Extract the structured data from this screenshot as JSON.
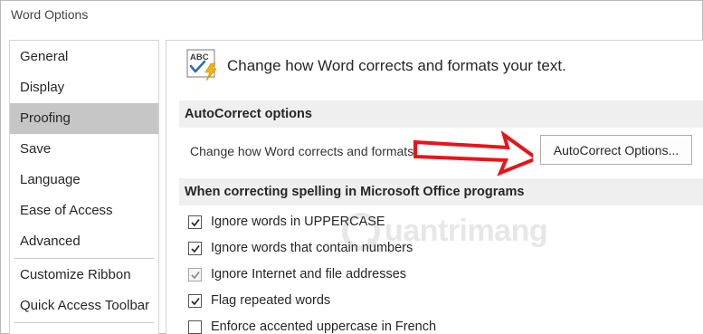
{
  "window": {
    "title": "Word Options"
  },
  "sidebar": {
    "items": [
      {
        "label": "General"
      },
      {
        "label": "Display"
      },
      {
        "label": "Proofing"
      },
      {
        "label": "Save"
      },
      {
        "label": "Language"
      },
      {
        "label": "Ease of Access"
      },
      {
        "label": "Advanced"
      },
      {
        "label": "Customize Ribbon"
      },
      {
        "label": "Quick Access Toolbar"
      }
    ],
    "selected": "Proofing"
  },
  "main": {
    "hero_icon": "abc-checkmark-lightning-icon",
    "hero_icon_text": "ABC",
    "hero_text": "Change how Word corrects and formats your text.",
    "autocorrect_section": {
      "header": "AutoCorrect options",
      "description": "Change how Word corrects and formats text as you type:",
      "button_label": "AutoCorrect Options..."
    },
    "spelling_section": {
      "header": "When correcting spelling in Microsoft Office programs",
      "options": [
        {
          "label": "Ignore words in UPPERCASE",
          "checked": true,
          "disabled": false
        },
        {
          "label": "Ignore words that contain numbers",
          "checked": true,
          "disabled": false
        },
        {
          "label": "Ignore Internet and file addresses",
          "checked": true,
          "disabled": true
        },
        {
          "label": "Flag repeated words",
          "checked": true,
          "disabled": false
        },
        {
          "label": "Enforce accented uppercase in French",
          "checked": false,
          "disabled": false
        }
      ]
    }
  },
  "annotation": {
    "arrow_color": "#e8141a"
  },
  "watermark": {
    "text": "uantrimang"
  },
  "colors": {
    "selected_nav_bg": "#c6c6c6",
    "section_header_bg": "#efefef",
    "icon_blue": "#2f6db5",
    "icon_yellow": "#f5b400"
  }
}
